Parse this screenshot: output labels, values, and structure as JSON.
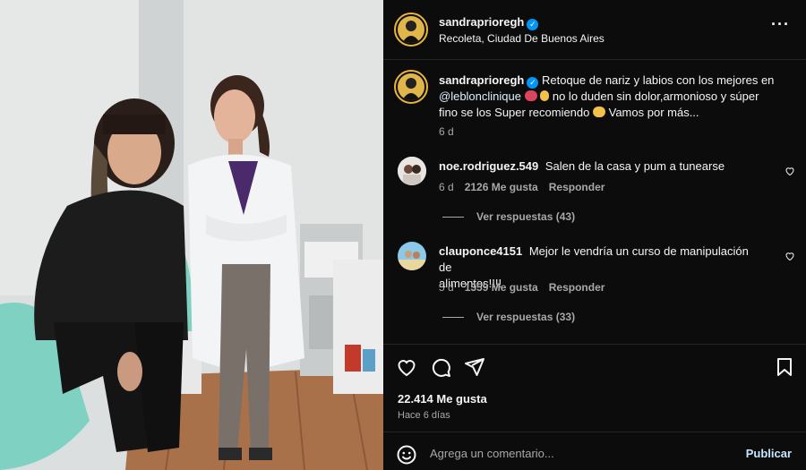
{
  "header": {
    "username": "sandraprioregh",
    "location": "Recoleta, Ciudad De Buenos Aires",
    "more_icon": "more-horizontal-icon",
    "verified_icon": "verified-badge-icon"
  },
  "caption": {
    "username": "sandraprioregh",
    "text_part1": "Retoque de nariz y labios con los mejores en",
    "mention": "@leblonclinique",
    "text_part2": "no lo duden sin dolor,armonioso y súper",
    "text_part3": "fino se los Super recomiendo",
    "text_part4": "Vamos por más...",
    "emoji_1": "lips-emoji",
    "emoji_2": "hand-emoji",
    "emoji_3": "raised-hands-emoji",
    "time": "6 d"
  },
  "comments": [
    {
      "username": "noe.rodriguez.549",
      "text": "Salen de la casa y pum a tunearse",
      "time": "6 d",
      "likes": "2126 Me gusta",
      "reply": "Responder",
      "view_replies": "Ver respuestas (43)"
    },
    {
      "username": "clauponce4151",
      "text_line1": "Mejor le vendría un curso de manipulación de",
      "text_line2": "alimentos!!!!",
      "time": "5 d",
      "likes": "1359 Me gusta",
      "reply": "Responder",
      "view_replies": "Ver respuestas (33)"
    }
  ],
  "actions": {
    "like_icon": "heart-icon",
    "comment_icon": "comment-icon",
    "share_icon": "share-icon",
    "save_icon": "bookmark-icon"
  },
  "stats": {
    "likes": "22.414 Me gusta",
    "posted": "Hace 6 días"
  },
  "comment_box": {
    "emoji_icon": "emoji-icon",
    "placeholder": "Agrega un comentario...",
    "publish": "Publicar"
  },
  "colors": {
    "background": "#0c0c0c",
    "verified": "#0095f6",
    "story_ring": "#e9b43f",
    "publish": "#c6e5ff"
  }
}
